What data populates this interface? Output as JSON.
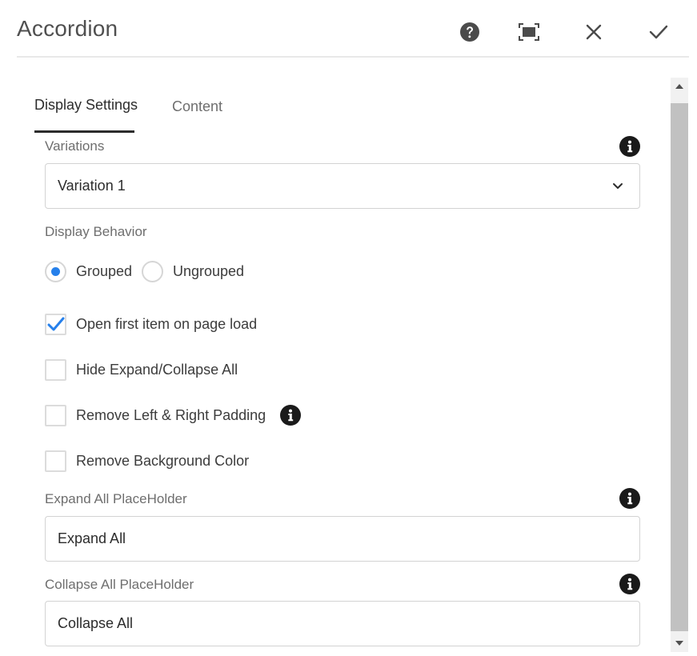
{
  "dialog": {
    "title": "Accordion",
    "actions": {
      "help_icon": "help-icon",
      "fullscreen_icon": "fullscreen-icon",
      "close_icon": "close-icon",
      "done_icon": "check-icon"
    }
  },
  "tabs": [
    {
      "label": "Display Settings",
      "active": true
    },
    {
      "label": "Content",
      "active": false
    }
  ],
  "form": {
    "variations": {
      "label": "Variations",
      "value": "Variation 1"
    },
    "display_behavior": {
      "label": "Display Behavior",
      "options": [
        {
          "label": "Grouped",
          "checked": true
        },
        {
          "label": "Ungrouped",
          "checked": false
        }
      ]
    },
    "checkboxes": [
      {
        "label": "Open first item on page load",
        "checked": true
      },
      {
        "label": "Hide Expand/Collapse All",
        "checked": false
      },
      {
        "label": "Remove Left & Right Padding",
        "checked": false
      },
      {
        "label": "Remove Background Color",
        "checked": false
      }
    ],
    "expand_placeholder": {
      "label": "Expand All PlaceHolder",
      "value": "Expand All"
    },
    "collapse_placeholder": {
      "label": "Collapse All PlaceHolder",
      "value": "Collapse All"
    }
  },
  "colors": {
    "accent": "#2680eb",
    "tab_underline": "#2c2c2c",
    "scroll_thumb": "#c1c1c1"
  }
}
